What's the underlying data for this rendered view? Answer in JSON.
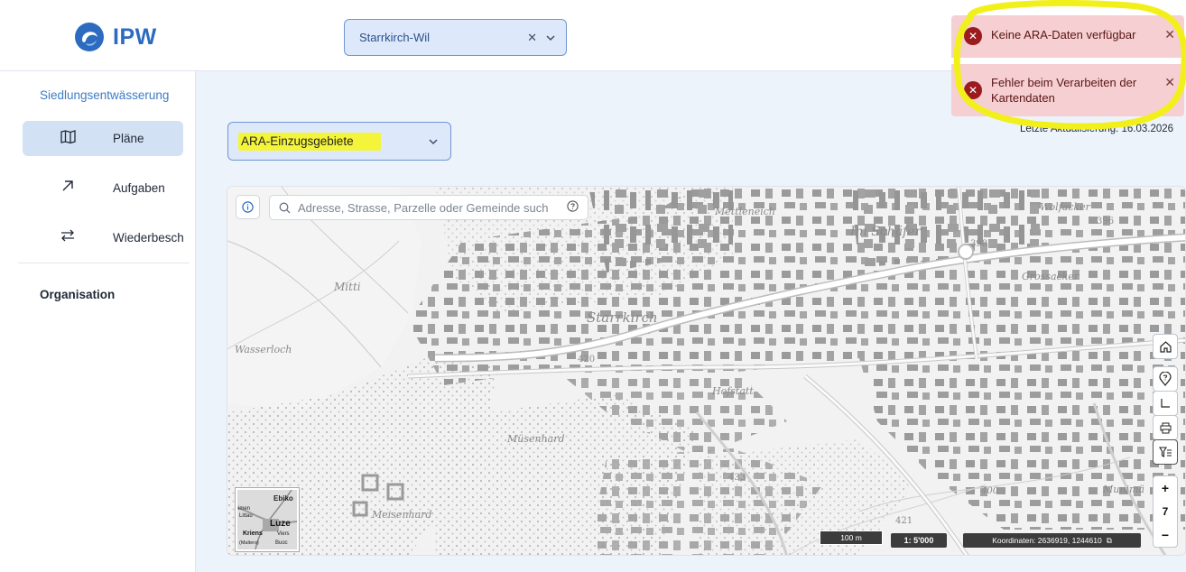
{
  "header": {
    "logo_text": "IPW",
    "site_select": {
      "value": "Starrkirch-Wil",
      "clear_icon": "close-icon",
      "expand_icon": "chevron-down-icon"
    }
  },
  "sidebar": {
    "section": "Siedlungsentwässerung",
    "items": [
      {
        "label": "Pläne",
        "icon": "map-icon",
        "active": true
      },
      {
        "label": "Aufgaben",
        "icon": "arrow-up-right-icon",
        "active": false
      },
      {
        "label": "Wiederbesch",
        "icon": "arrows-exchange-icon",
        "active": false
      }
    ],
    "organisation": "Organisation"
  },
  "layer_select": {
    "value": "ARA-Einzugsgebiete",
    "expand_icon": "chevron-down-icon"
  },
  "last_update": "Letzte Aktualisierung: 16.03.2026",
  "notifications": [
    {
      "message": "Keine ARA-Daten verfügbar",
      "icon": "error-circle-icon",
      "color": "#9b1b1f"
    },
    {
      "message": "Fehler beim Verarbeiten der Kartendaten",
      "icon": "error-circle-icon",
      "color": "#9b1b1f"
    }
  ],
  "map": {
    "search": {
      "placeholder": "Adresse, Strasse, Parzelle oder Gemeinde such"
    },
    "labels": {
      "mettleneich": "Mettleneich",
      "im_schaefer": "Im Schäfer",
      "wolfacker": "Wolfacker",
      "h396": "396",
      "h398": "398",
      "grossacker": "Grossacker",
      "mitti": "Mitti",
      "starrkirch": "Starrkirch",
      "wasserloch": "Wasserloch",
      "h420": "420",
      "hofstatt": "Hofstatt",
      "musenhard": "Müsenhard",
      "h433": "433",
      "h400": "400",
      "munima": "Munimä",
      "h421": "421",
      "meisenhard": "Meisenhard"
    },
    "minimap_labels": [
      "Ebiko",
      "imen",
      "Littau",
      "Luze",
      "Kriens",
      "Viers",
      "(Malters)",
      "Buoc"
    ],
    "zoom_level": "7",
    "zoom_in": "+",
    "zoom_out": "−",
    "scale_bar": "100 m",
    "scale": "1: 5'000",
    "coordinates": "Koordinaten: 2636919, 1244610",
    "tools": [
      "home-icon",
      "location-help-icon",
      "measure-icon",
      "print-icon",
      "filter-icon"
    ]
  },
  "colors": {
    "accent": "#2c6bc0",
    "select_bg": "#dde9fb",
    "error_bg": "#f5cfd1",
    "highlight": "#f4f53a"
  }
}
